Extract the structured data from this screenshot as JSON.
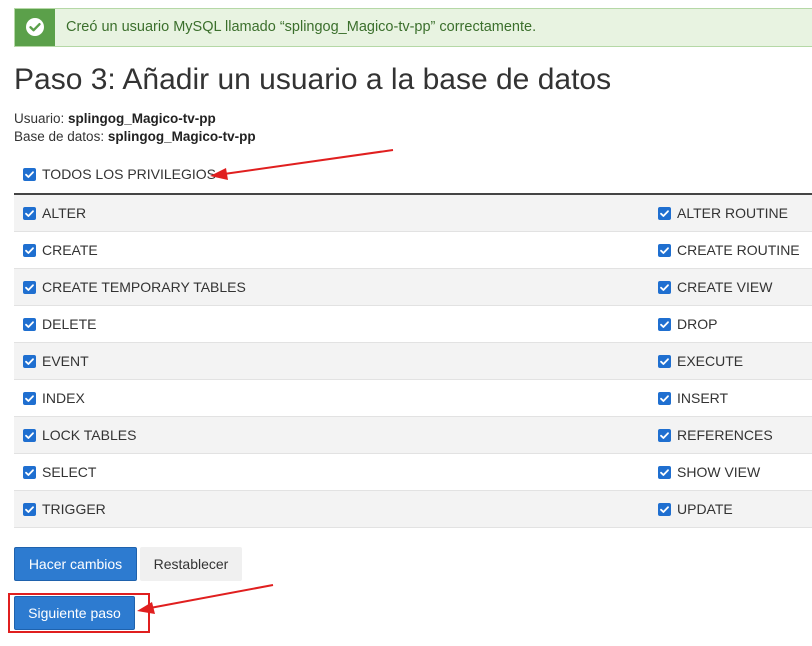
{
  "alert": {
    "message": "Creó un usuario MySQL llamado “splingog_Magico-tv-pp” correctamente.",
    "icon": "check-circle-icon",
    "color": "#5ba04a"
  },
  "title": "Paso 3: Añadir un usuario a la base de datos",
  "user": {
    "label": "Usuario:",
    "value": "splingog_Magico-tv-pp"
  },
  "database": {
    "label": "Base de datos:",
    "value": "splingog_Magico-tv-pp"
  },
  "all_privileges": {
    "label": "TODOS LOS PRIVILEGIOS",
    "checked": true
  },
  "privileges": [
    {
      "left": "ALTER",
      "right": "ALTER ROUTINE"
    },
    {
      "left": "CREATE",
      "right": "CREATE ROUTINE"
    },
    {
      "left": "CREATE TEMPORARY TABLES",
      "right": "CREATE VIEW"
    },
    {
      "left": "DELETE",
      "right": "DROP"
    },
    {
      "left": "EVENT",
      "right": "EXECUTE"
    },
    {
      "left": "INDEX",
      "right": "INSERT"
    },
    {
      "left": "LOCK TABLES",
      "right": "REFERENCES"
    },
    {
      "left": "SELECT",
      "right": "SHOW VIEW"
    },
    {
      "left": "TRIGGER",
      "right": "UPDATE"
    }
  ],
  "buttons": {
    "make_changes": "Hacer cambios",
    "reset": "Restablecer",
    "next_step": "Siguiente paso"
  },
  "colors": {
    "primary": "#2d7bd0",
    "checkbox": "#1f6fd0",
    "annotation": "#e01f1f"
  }
}
